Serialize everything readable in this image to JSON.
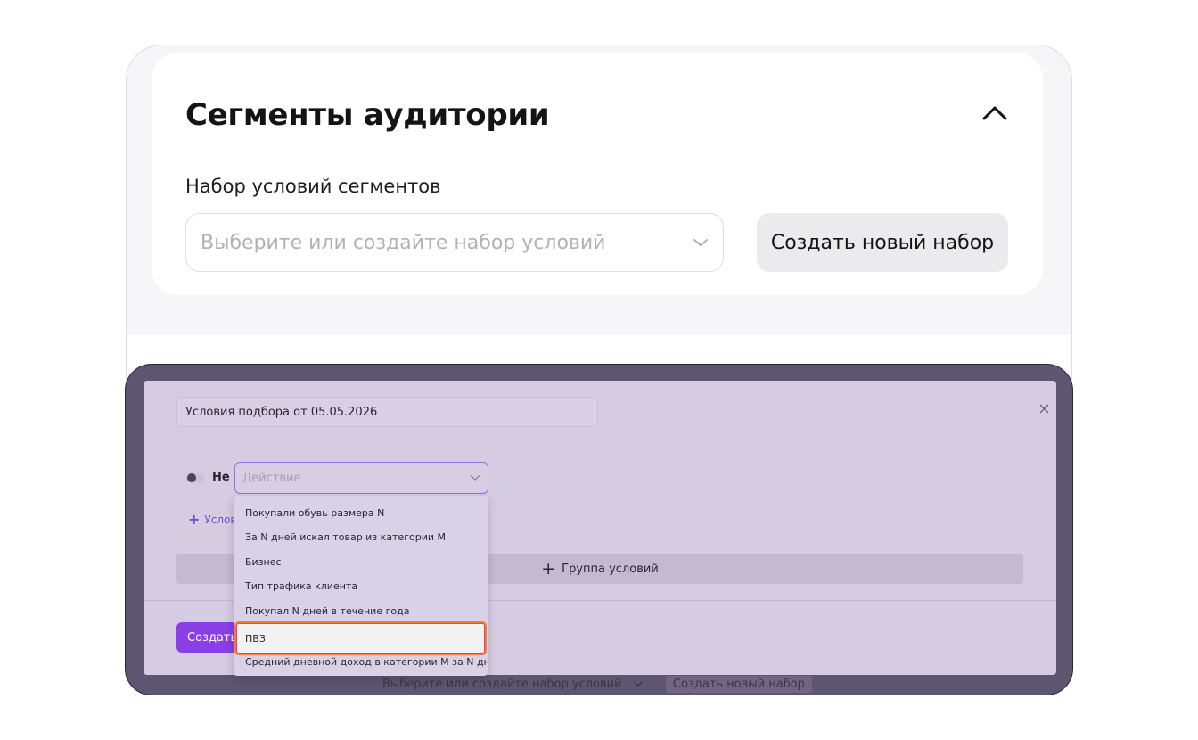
{
  "segments": {
    "title": "Сегменты аудитории",
    "label": "Набор условий сегментов",
    "select_placeholder": "Выберите или создайте набор условий",
    "create_set_label": "Создать новый набор"
  },
  "modal": {
    "name_value": "Условия подбора от 05.05.2026",
    "not_label": "Не",
    "action_placeholder": "Действие",
    "add_condition_label": "Услови",
    "group_label": "Группа условий",
    "create_label": "Создать",
    "dropdown_items": [
      "Покупали обувь размера N",
      "За N дней искал товар из категории M",
      "Бизнес",
      "Тип трафика клиента",
      "Покупал N дней в течение года",
      "ПВЗ",
      "Средний дневной доход в категории M за N дней"
    ],
    "highlighted_index": 5
  },
  "background_form": {
    "select_placeholder": "Выберите или создайте набор условий",
    "create_set_label": "Создать новый набор"
  },
  "colors": {
    "accent": "#8a3ee6",
    "overlay": "#5e5570",
    "highlight_border": "#f07e2c"
  }
}
